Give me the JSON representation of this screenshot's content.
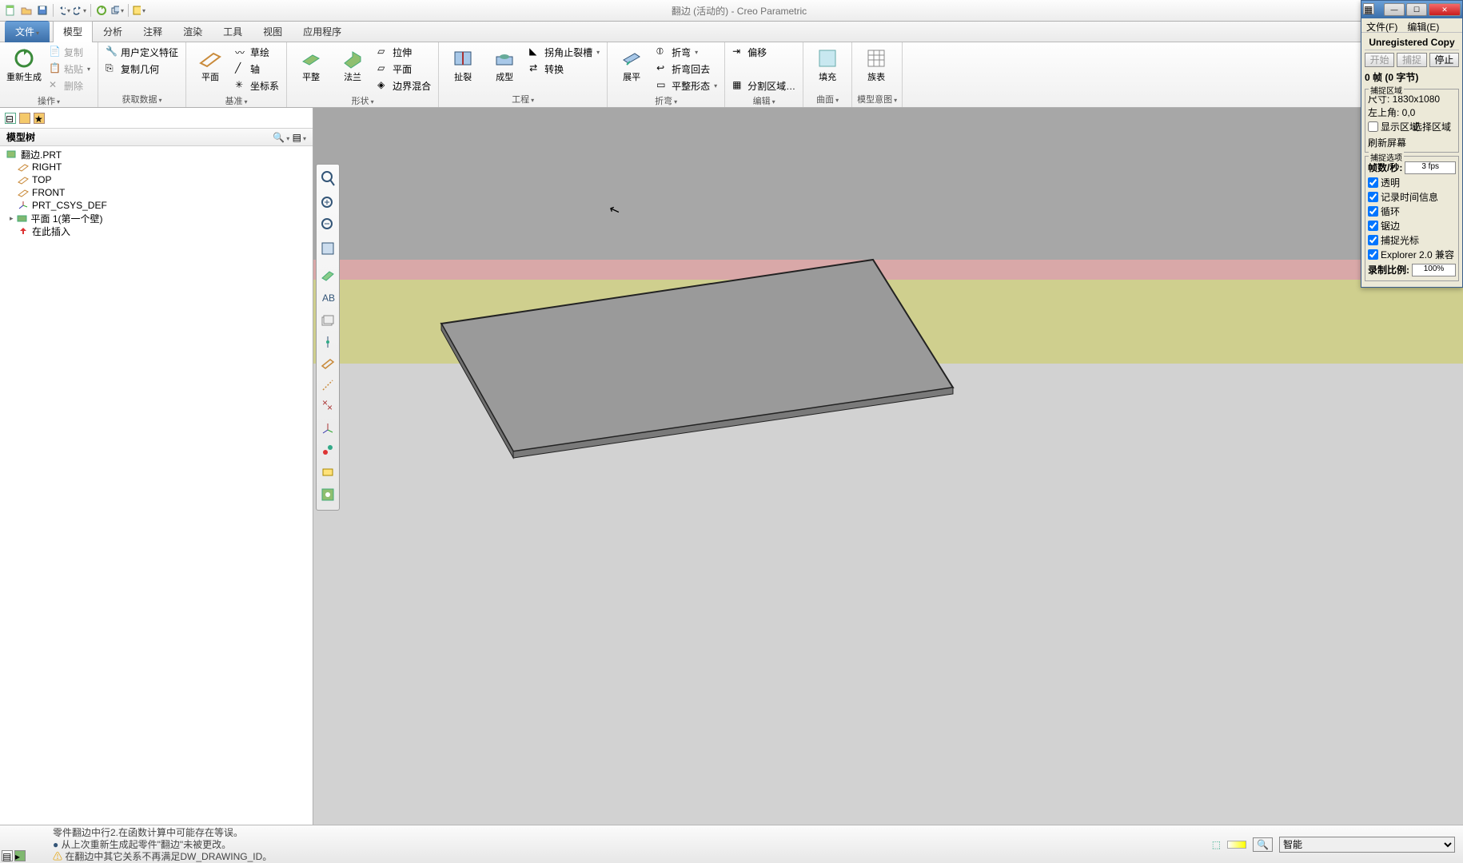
{
  "title": "翻边 (活动的) - Creo Parametric",
  "tabs": {
    "file": "文件",
    "model": "模型",
    "analysis": "分析",
    "annotate": "注释",
    "render": "渲染",
    "tools": "工具",
    "view": "视图",
    "apps": "应用程序"
  },
  "ribbon": {
    "regen": "重新生成",
    "copy": "复制",
    "paste": "粘贴",
    "delete": "删除",
    "operate": "操作",
    "udf": "用户定义特征",
    "copygeo": "复制几何",
    "getdata": "获取数据",
    "plane": "平面",
    "sketch": "草绘",
    "axis": "轴",
    "csys": "坐标系",
    "datum": "基准",
    "flat": "平整",
    "flange": "法兰",
    "extrude": "拉伸",
    "planar": "平面",
    "blend": "边界混合",
    "shape": "形状",
    "rip": "扯裂",
    "form": "成型",
    "corner": "拐角止裂槽",
    "convert": "转换",
    "engineering": "工程",
    "unbend": "展平",
    "bend": "折弯",
    "bendback": "折弯回去",
    "flatform": "平整形态",
    "bending": "折弯",
    "offset": "偏移",
    "split": "分割区域…",
    "edit": "编辑",
    "fill": "填充",
    "family": "族表",
    "surface": "曲面",
    "intent": "模型意图"
  },
  "tree": {
    "header": "模型树",
    "items": [
      "翻边.PRT",
      "RIGHT",
      "TOP",
      "FRONT",
      "PRT_CSYS_DEF",
      "平面 1(第一个壁)",
      "在此插入"
    ]
  },
  "status": {
    "l1": "零件翻边中行2.在函数计算中可能存在等误。",
    "l2": "从上次重新生成起零件\"翻边\"未被更改。",
    "l3": "在翻边中其它关系不再满足DW_DRAWING_ID。",
    "filter": "智能"
  },
  "panel": {
    "menu_file": "文件(F)",
    "menu_edit": "编辑(E)",
    "unreg": "Unregistered Copy",
    "start": "开始",
    "capture": "捕捉",
    "stop": "停止",
    "frames_info": "0 帧 (0 字节)",
    "region_title": "捕捉区域",
    "size_label": "尺寸: 1830x1080",
    "origin_label": "左上角: 0,0",
    "showregion": "显示区域",
    "selregion": "选择区域",
    "refresh": "刷新屏幕",
    "opts_title": "捕捉选项",
    "fps_label": "帧数/秒:",
    "fps_val": "3 fps",
    "transparent": "透明",
    "timeinfo": "记录时间信息",
    "loop": "循环",
    "dither": "锯边",
    "cursor": "捕捉光标",
    "explorer": "Explorer 2.0 兼容",
    "ratio_label": "录制比例:",
    "ratio_val": "100%"
  }
}
